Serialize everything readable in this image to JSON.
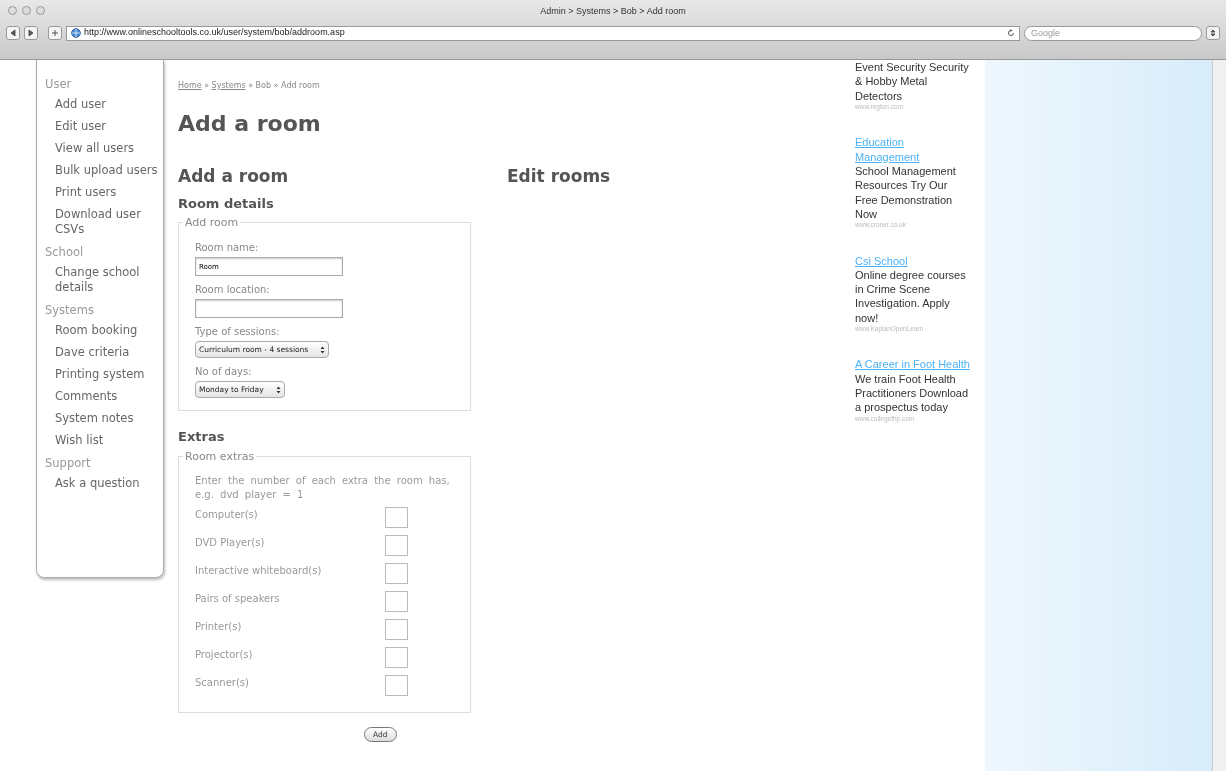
{
  "window": {
    "title": "Admin > Systems > Bob > Add room",
    "url": "http://www.onlineschooltools.co.uk/user/system/bob/addroom.asp",
    "search": {
      "placeholder": "Google"
    }
  },
  "sidebar": {
    "sections": [
      {
        "heading": "User",
        "items": [
          "Add user",
          "Edit user",
          "View all users",
          "Bulk upload users",
          "Print users",
          "Download user CSVs"
        ]
      },
      {
        "heading": "School",
        "items": [
          "Change school details"
        ]
      },
      {
        "heading": "Systems",
        "items": [
          "Room booking",
          "Dave criteria",
          "Printing system",
          "Comments",
          "System notes",
          "Wish list"
        ]
      },
      {
        "heading": "Support",
        "items": [
          "Ask a question"
        ]
      }
    ]
  },
  "breadcrumb": {
    "separator": "»",
    "items": [
      {
        "label": "Home",
        "kind": "link"
      },
      {
        "label": "Systems",
        "kind": "link"
      },
      {
        "label": "Bob",
        "kind": "text"
      },
      {
        "label": "Add room",
        "kind": "text"
      }
    ]
  },
  "page_title": "Add a room",
  "form": {
    "heading": "Add a room",
    "subheading": "Room details",
    "legend": "Add room",
    "fields": [
      {
        "label": "Room name:",
        "kind": "text",
        "value": "Room"
      },
      {
        "label": "Room location:",
        "kind": "text"
      },
      {
        "label": "Type of sessions:",
        "kind": "select",
        "value": "Curriculum room - 4 sessions"
      },
      {
        "label": "No of days:",
        "kind": "select",
        "value": "Monday to Friday"
      }
    ],
    "extras": {
      "heading": "Extras",
      "legend": "Room extras",
      "instructions": "Enter the number of each extra the room has, e.g. dvd player = 1",
      "items": [
        "Computer(s)",
        "DVD Player(s)",
        "Interactive whiteboard(s)",
        "Pairs of speakers",
        "Printer(s)",
        "Projector(s)",
        "Scanner(s)"
      ]
    },
    "submit": "Add"
  },
  "edit_heading": "Edit rooms",
  "ads": [
    {
      "body": "Event Security Security & Hobby Metal Detectors",
      "url": "www.regton.com"
    },
    {
      "title": "Education Management",
      "body": "School Management Resources Try Our Free Demonstration Now",
      "url": "www.croner.co.uk"
    },
    {
      "title": "Csi School",
      "body": "Online degree courses in Crime Scene Investigation. Apply now!",
      "url": "www.KaplanOpenLearn"
    },
    {
      "title": "A Career in Foot Health",
      "body": "We train Foot Health Practitioners Download a prospectus today",
      "url": "www.collegefhp.com"
    }
  ]
}
